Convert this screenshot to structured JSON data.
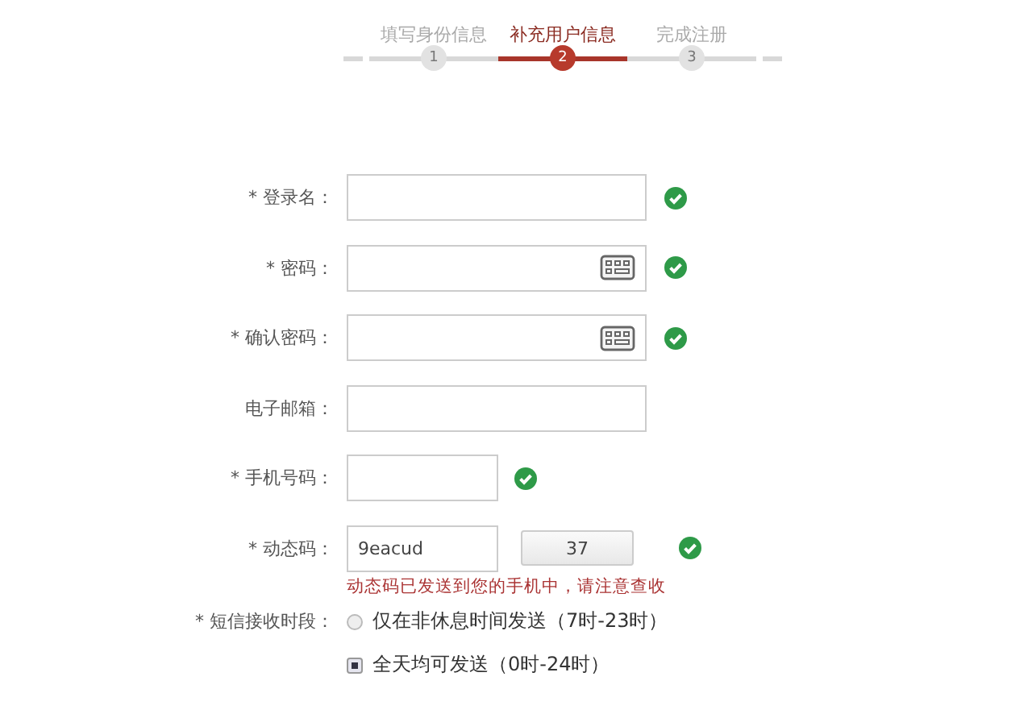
{
  "steps": [
    {
      "label": "填写身份信息",
      "number": "1",
      "selected": false
    },
    {
      "label": "补充用户信息",
      "number": "2",
      "selected": true
    },
    {
      "label": "完成注册",
      "number": "3",
      "selected": false
    }
  ],
  "fields": [
    {
      "label": "* 登录名：",
      "kind": "text",
      "valid": true
    },
    {
      "label": "* 密码：",
      "kind": "password",
      "valid": true
    },
    {
      "label": "* 确认密码：",
      "kind": "password",
      "valid": true
    },
    {
      "label": "电子邮箱：",
      "kind": "text",
      "valid": false
    },
    {
      "label": "* 手机号码：",
      "kind": "short",
      "valid": true
    },
    {
      "label": "* 动态码：",
      "kind": "code",
      "value": "9eacud",
      "button": "37",
      "valid": true
    }
  ],
  "hint": "动态码已发送到您的手机中，请注意查收",
  "sms_period": {
    "label": "* 短信接收时段：",
    "options": [
      {
        "label": "仅在非休息时间发送（7时-23时）",
        "selected": false
      },
      {
        "label": "全天均可发送（0时-24时）",
        "selected": true
      }
    ]
  }
}
